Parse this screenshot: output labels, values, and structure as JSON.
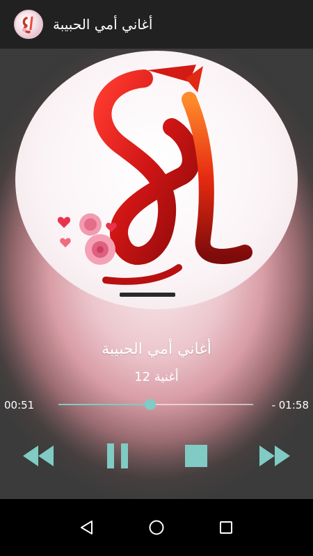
{
  "app_bar": {
    "title": "أغاني أمي الحبيبة",
    "icon": "app-logo-icon"
  },
  "player": {
    "title": "أغاني أمي الحبيبة",
    "subtitle": "أغنية 12",
    "time_current": "00:51",
    "time_total": "- 01:58",
    "progress": 0.47,
    "accent_color": "#80cbc4"
  },
  "controls": {
    "rewind": "rewind-icon",
    "pause": "pause-icon",
    "stop": "stop-icon",
    "fast_forward": "fast-forward-icon"
  },
  "nav_bar": {
    "back": "back-triangle-icon",
    "home": "home-circle-icon",
    "recents": "recents-square-icon"
  }
}
